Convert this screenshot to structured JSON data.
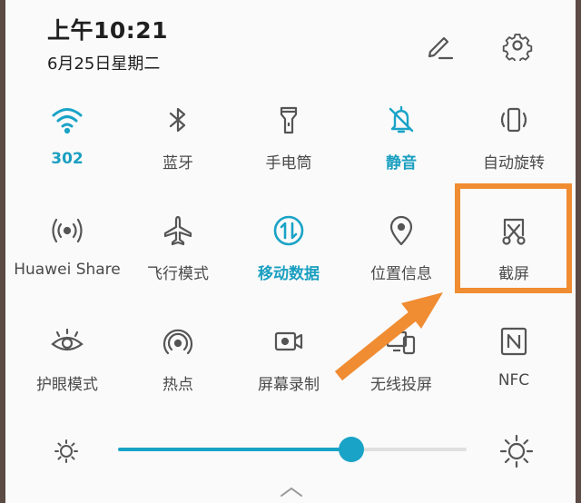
{
  "status": {
    "time": "上午10:21",
    "date": "6月25日星期二"
  },
  "header": {
    "edit_icon": "pencil-icon",
    "settings_icon": "gear-icon"
  },
  "tiles": [
    {
      "label": "302",
      "icon": "wifi-icon",
      "active": true
    },
    {
      "label": "蓝牙",
      "icon": "bluetooth-icon",
      "active": false
    },
    {
      "label": "手电筒",
      "icon": "flashlight-icon",
      "active": false
    },
    {
      "label": "静音",
      "icon": "bell-off-icon",
      "active": true
    },
    {
      "label": "自动旋转",
      "icon": "auto-rotate-icon",
      "active": false
    },
    {
      "label": "Huawei Share",
      "icon": "huawei-share-icon",
      "active": false
    },
    {
      "label": "飞行模式",
      "icon": "airplane-icon",
      "active": false
    },
    {
      "label": "移动数据",
      "icon": "mobile-data-icon",
      "active": true
    },
    {
      "label": "位置信息",
      "icon": "location-icon",
      "active": false
    },
    {
      "label": "截屏",
      "icon": "screenshot-icon",
      "active": false
    },
    {
      "label": "护眼模式",
      "icon": "eye-icon",
      "active": false
    },
    {
      "label": "热点",
      "icon": "hotspot-icon",
      "active": false
    },
    {
      "label": "屏幕录制",
      "icon": "screen-record-icon",
      "active": false
    },
    {
      "label": "无线投屏",
      "icon": "wireless-projection-icon",
      "active": false
    },
    {
      "label": "NFC",
      "icon": "nfc-icon",
      "active": false
    }
  ],
  "brightness": {
    "level": 0.67
  },
  "colors": {
    "accent": "#19a3c7",
    "annotation": "#f08c32"
  }
}
